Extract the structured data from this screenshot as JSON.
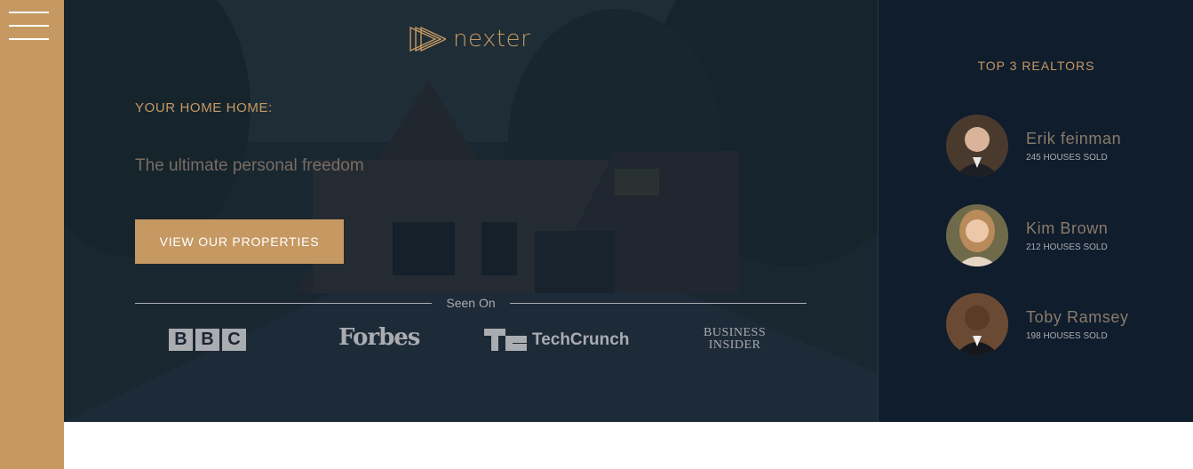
{
  "sidebar": {
    "menu_icon": "hamburger-icon"
  },
  "header": {
    "logo_text": "nexter",
    "logo_icon": "triangles-play-icon",
    "subtitle": "YOUR HOME HOME:",
    "heading": "The ultimate personal freedom",
    "cta_label": "VIEW OUR PROPERTIES",
    "seen_on_label": "Seen On",
    "press_logos": {
      "bbc": [
        "B",
        "B",
        "C"
      ],
      "forbes": "Forbes",
      "techcrunch": "TechCrunch",
      "business_insider_line1": "BUSINESS",
      "business_insider_line2": "INSIDER"
    }
  },
  "realtors": {
    "title": "TOP 3 REALTORS",
    "items": [
      {
        "name": "Erik feinman",
        "sold": "245 HOUSES SOLD"
      },
      {
        "name": "Kim Brown",
        "sold": "212 HOUSES SOLD"
      },
      {
        "name": "Toby Ramsey",
        "sold": "198 HOUSES SOLD"
      }
    ]
  },
  "colors": {
    "accent": "#c69963",
    "dark_blue": "#101d2c",
    "grey": "#a9acb1"
  }
}
